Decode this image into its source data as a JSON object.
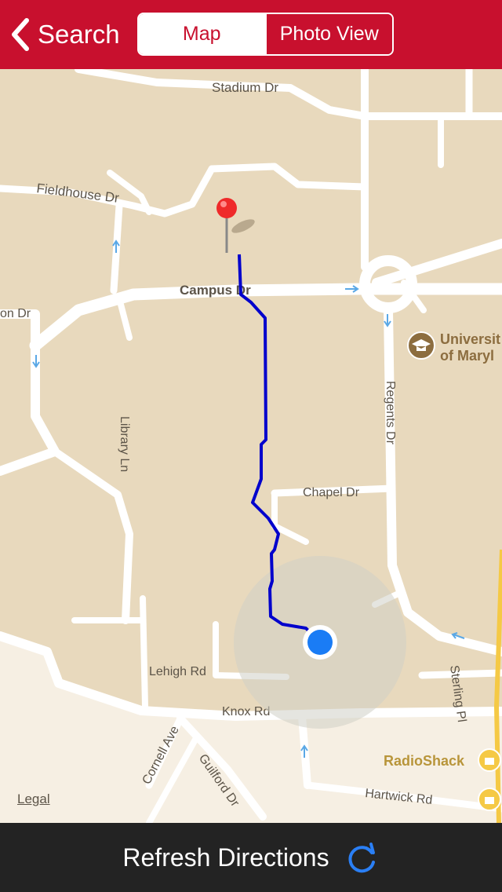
{
  "nav": {
    "back_label": "Search",
    "tabs": [
      {
        "label": "Map",
        "selected": true
      },
      {
        "label": "Photo View",
        "selected": false
      }
    ],
    "background_color": "#c8102e"
  },
  "map": {
    "road_labels": {
      "stadium": "Stadium Dr",
      "fieldhouse": "Fieldhouse Dr",
      "campus": "Campus Dr",
      "on": "on Dr",
      "library": "Library Ln",
      "regents": "Regents Dr",
      "chapel": "Chapel Dr",
      "lehigh": "Lehigh Rd",
      "knox": "Knox Rd",
      "cornell": "Cornell Ave",
      "guilford": "Guilford Dr",
      "hartwick": "Hartwick Rd",
      "sterling": "Sterling Pl"
    },
    "poi": [
      {
        "name_line1": "Universit",
        "name_line2": "of Maryl",
        "icon": "graduation-cap-icon"
      },
      {
        "name": "RadioShack",
        "icon": "shopping-bag-icon"
      }
    ],
    "legal": "Legal",
    "route_color": "#0000cc",
    "location_color": "#1a7cf5"
  },
  "bottom_bar": {
    "label": "Refresh Directions",
    "icon": "refresh-icon"
  }
}
